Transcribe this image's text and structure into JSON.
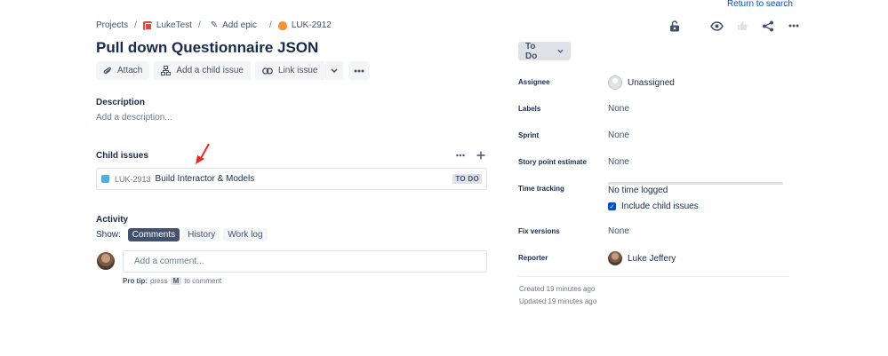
{
  "header": {
    "return_link": "Return to search",
    "breadcrumb": {
      "projects": "Projects",
      "project": "LukeTest",
      "epic": "Add epic",
      "issue_key": "LUK-2912"
    }
  },
  "issue": {
    "title": "Pull down Questionnaire JSON",
    "toolbar": {
      "attach": "Attach",
      "add_child": "Add a child issue",
      "link_issue": "Link issue"
    },
    "description": {
      "heading": "Description",
      "placeholder": "Add a description..."
    },
    "child_issues": {
      "heading": "Child issues",
      "items": [
        {
          "key": "LUK-2913",
          "summary": "Build Interactor & Models",
          "status": "TO DO"
        }
      ]
    },
    "activity": {
      "heading": "Activity",
      "show_label": "Show:",
      "tabs": [
        "Comments",
        "History",
        "Work log"
      ],
      "active_tab": "Comments",
      "comment_placeholder": "Add a comment...",
      "pro_tip_label": "Pro tip:",
      "pro_tip_press": "press",
      "pro_tip_key": "M",
      "pro_tip_suffix": "to comment"
    }
  },
  "sidebar": {
    "status": "To Do",
    "fields": {
      "assignee": {
        "label": "Assignee",
        "value": "Unassigned"
      },
      "labels": {
        "label": "Labels",
        "value": "None"
      },
      "sprint": {
        "label": "Sprint",
        "value": "None"
      },
      "story_points": {
        "label": "Story point estimate",
        "value": "None"
      },
      "time_tracking": {
        "label": "Time tracking",
        "value": "No time logged",
        "checkbox_label": "Include child issues",
        "checkbox_checked": true
      },
      "fix_versions": {
        "label": "Fix versions",
        "value": "None"
      },
      "reporter": {
        "label": "Reporter",
        "value": "Luke Jeffery"
      }
    },
    "created": "Created 19 minutes ago",
    "updated": "Updated 19 minutes ago"
  },
  "colors": {
    "accent": "#0052cc",
    "text": "#172b4d",
    "arrow": "#e8291c"
  }
}
